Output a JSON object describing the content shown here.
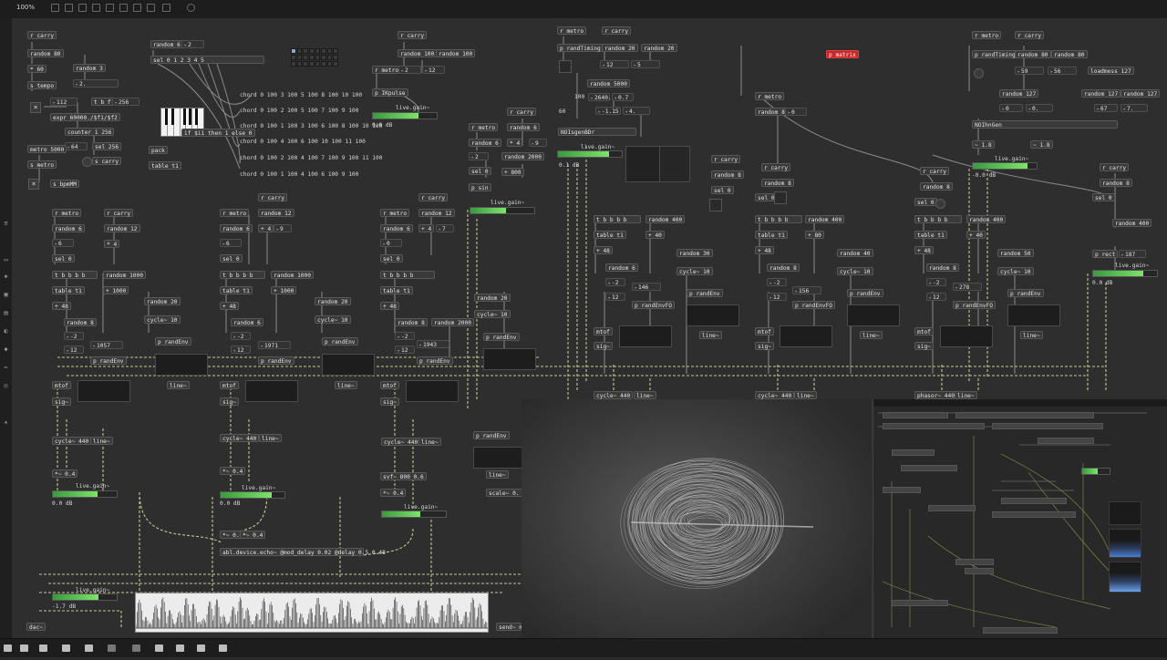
{
  "toolbar": {
    "zoom": "100%"
  },
  "bottombar": {
    "icons": [
      "lock-icon",
      "presentation-icon",
      "grid-icon",
      "console-icon",
      "inspector-icon",
      "cut-icon",
      "wrench-icon",
      "palette-icon",
      "grid-snap-icon"
    ]
  },
  "patch": {
    "o_rcarry_1": "r carry",
    "o_random80_1": "random 80",
    "o_mul60": "* 60",
    "o_random3": "random 3",
    "o_num2": "2.",
    "o_stempo": "s tempo",
    "o_random6_a": "random 6",
    "o_num2b": "2",
    "o_sel012345": "sel 0 1 2 3 4 5",
    "o_num112": "112",
    "o_tbf": "t b f",
    "o_256": "256",
    "o_expr": "expr 60000./$f1/$f2",
    "o_counter": "counter 1 256",
    "o_num64": "64",
    "o_sel256": "sel 256",
    "o_metro5000": "metro 5000",
    "o_smetro": "s metro",
    "o_scarry": "s carry",
    "o_pack": "pack",
    "o_table_t1": "table t1",
    "o_sbpmmm": "s bpmMM",
    "chord1": "chord 0 100 3 100 5 100 8 100 10 100",
    "chord2": "chord 0 100 2 100 5 100 7 100 9 100",
    "chord3": "chord 0 100 1 100 3 100 6 100 8 100 10 100",
    "chord4": "chord 0 100 4 100 6 100 10 100 11 100",
    "chord5": "chord 0 100 2 100 4 100 7 100 9 100 11 100",
    "chord6": "chord 0 100 1 100 4 100 6 100 9 100",
    "o_if": "if $i1 then 1 else 0",
    "o_rcarry_2": "r carry",
    "o_random100_a": "random 100",
    "o_random100_b": "random 100",
    "o_rmetro_2": "r metro",
    "o_num2c": "2",
    "o_num12": "12",
    "o_pikpulse": "p IKpulse",
    "o_livegain_1": "live.gain~",
    "o_db_1": "0.0 dB",
    "o_rmetro_3": "r metro",
    "o_rcarry_3": "r carry",
    "o_random6_b": "random 6",
    "o_random6_c": "random 6",
    "o_num2d": "2",
    "o_mul4": "* 4",
    "o_num9": "9",
    "o_random2000": "random 2000",
    "o_sel0_a": "sel 0",
    "o_plus800": "+ 800",
    "o_psin": "p sin",
    "o_livegain_2": "live.gain~",
    "o_rmetro_4": "r metro",
    "o_rcarry_4": "r carry",
    "o_prandtiming": "p randTiming",
    "o_random20_a": "random 20",
    "o_random20_b": "random 20",
    "o_num12b": "12",
    "o_num5": "5",
    "o_random5000": "random 5000",
    "o_num100": "100",
    "o_num2640": "2640.",
    "o_num07": "0.7",
    "o_num60": "60",
    "o_numm115": "-1.15",
    "o_num4": "4.",
    "o_noisegenbdr": "NOIsgenBDr",
    "o_livegain_3": "live.gain~",
    "o_db_3": "0.1 dB",
    "o_pmatrix": "p matrix",
    "o_rmetro_5": "r metro",
    "o_rcarry_5": "r carry",
    "o_prandtiming_2": "p randTiming",
    "o_random80_2": "random 80",
    "o_random80_3": "random 80",
    "o_num59": "59",
    "o_num56": "56",
    "o_loadmess": "loadmess 127",
    "o_random127_a": "random 127",
    "o_random127_b": "random 127",
    "o_random127_c": "random 127",
    "o_num0": "0",
    "o_num0b": "0.",
    "o_num67": "67",
    "o_num7": "7.",
    "o_noisegen": "NOIhnGen",
    "o_num18": "~ 1.8",
    "o_num18b": "~ 1.8",
    "o_livegain_5": "live.gain~",
    "o_db_5": "-0.0 dB",
    "v1": {
      "rmetro": "r metro",
      "rcarry": "r carry",
      "random6": "random 6",
      "random12": "random 12",
      "num6": "6",
      "mul4": "* 4",
      "sel0": "sel 0",
      "tbbbb": "t b b b b",
      "random1000": "random 1000",
      "tablet1": "table t1",
      "plus1000": "+ 1000",
      "plus48": "+ 48",
      "random20": "random 20",
      "random8": "random 8",
      "cycle10": "cycle~ 10",
      "num2": "-2",
      "num12": "12",
      "num1057": "1057",
      "prandenv": "p randEnv",
      "prandenv2": "p randEnv",
      "mtof": "mtof",
      "line": "line~",
      "sig": "sig~",
      "cycle440": "cycle~ 440",
      "line2": "line~",
      "mul04": "*~ 0.4",
      "livegain": "live.gain~",
      "db": "0.0 dB"
    },
    "v2": {
      "rmetro": "r metro",
      "rcarry": "r carry",
      "random6": "random 6",
      "random12": "random 12",
      "num6": "6",
      "mul4": "+ 4",
      "num9": "9",
      "sel0": "sel 0",
      "tbbbb": "t b b b b",
      "random1000": "random 1000",
      "tablet1": "table t1",
      "plus1000": "+ 1000",
      "plus48": "+ 48",
      "random20": "random 20",
      "random8": "random 6",
      "cycle10": "cycle~ 10",
      "num2": "-2",
      "num12": "12",
      "num1971": "1971",
      "prandenv": "p randEnv",
      "prandenv2": "p randEnv",
      "mtof": "mtof",
      "line": "line~",
      "sig": "sig~",
      "cycle440": "cycle~ 440",
      "line2": "line~",
      "mul04": "*~ 0.4",
      "livegain": "live.gain~",
      "db": "0.0 dB"
    },
    "v3": {
      "rmetro": "r metro",
      "rcarry": "r carry",
      "random6": "random 6",
      "random12": "random 12",
      "num0": "0",
      "mul4": "+ 4",
      "num7": "7",
      "sel0": "sel 0",
      "tbbbb": "t b b b b",
      "tablet1": "table t1",
      "plus48": "+ 48",
      "random8": "random 8",
      "random2000": "random 2000",
      "num2": "-2",
      "num12": "12",
      "num1943": "1943",
      "prandenv": "p randEnv",
      "random20": "random 20",
      "cycle10": "cycle~ 10",
      "prandenv2": "p randEnv",
      "mtof": "mtof",
      "line": "line~",
      "sig": "sig~",
      "cycle440": "cycle~ 440",
      "line2": "line~",
      "svf": "svf~ 800 0.6",
      "prandenv3": "p randEnv",
      "mul04": "*~ 0.4",
      "scale": "scale~ 0. 1.",
      "livegain": "live.gain~"
    },
    "v4": {
      "rcarry": "r carry",
      "random8": "random 8",
      "sel0": "sel 0",
      "tbbbb": "t b b b b",
      "random400": "random 400",
      "tablet1": "table t1",
      "plus40": "+ 40",
      "plus48": "+ 48",
      "random30": "random 30",
      "random6": "random 6",
      "cycle10": "cycle~ 10",
      "num2": "-2",
      "num146": "146",
      "num12": "12",
      "prandenv": "p randEnv",
      "prandenvfo": "p randEnvFO",
      "mtof": "mtof",
      "line": "line~",
      "sig": "sig~",
      "cycle440": "cycle~ 440",
      "line2": "line~",
      "livegain": "live.gain~"
    },
    "v5": {
      "rmetro": "r metro",
      "random8": "random 8",
      "num0": "0",
      "rcarry": "r carry",
      "random8b": "random 8",
      "sel0": "sel 0",
      "tbbbb": "t b b b b",
      "random400": "random 400",
      "tablet1": "table t1",
      "plus80": "+ 80",
      "plus48": "+ 48",
      "random40": "random 40",
      "random8c": "random 8",
      "cycle10": "cycle~ 10",
      "num2": "-2",
      "num156": "156",
      "num12": "12",
      "prandenv": "p randEnv",
      "prandenvfo": "p randEnvFO",
      "mtof": "mtof",
      "line": "line~",
      "sig": "sig~",
      "cycle440": "cycle~ 440",
      "line2": "line~"
    },
    "v6": {
      "rcarry": "r carry",
      "random8": "random 8",
      "sel0": "sel 0",
      "tbbbb": "t b b b b",
      "random400": "random 400",
      "tablet1": "table t1",
      "plus40": "+ 40",
      "plus48": "+ 48",
      "random50": "random 50",
      "random8b": "random 8",
      "cycle10": "cycle~ 10",
      "num2": "-2",
      "num278": "278",
      "num12": "12",
      "prandenv": "p randEnv",
      "prandenvfo": "p randEnvFO",
      "mtof": "mtof",
      "line": "line~",
      "sig": "sig~",
      "phasor": "phasor~ 440",
      "line2": "line~"
    },
    "v7": {
      "rcarry": "r carry",
      "random8": "random 8",
      "sel0": "sel 0",
      "random400": "random 400",
      "rect": "p rect",
      "num187": "187",
      "livegain": "live.gain~",
      "db": "0.0 dB"
    },
    "o_echo": "abl.device.echo~ @mod_delay 0.02 @delay 0.5 0.48",
    "o_mul04_1": "*~ 0.4",
    "o_mul04_2": "*~ 0.4",
    "o_livegain_out": "live.gain~",
    "o_db_out": "-1.7 dB",
    "o_dac": "dac~",
    "o_send": "send~ m"
  },
  "gains": {
    "g1": 0.72,
    "g2": 0.55,
    "g3": 0.8,
    "g4": 0.85,
    "g5": 0.7,
    "g6": 0.8,
    "g7": 0.6,
    "g8": 0.78
  },
  "colors": {
    "background": "#2e2e2e",
    "object": "#3a3a3a",
    "accent_green": "#7ee46a",
    "signal_wire": "#d9d99a",
    "matrix_red": "#c62828"
  }
}
